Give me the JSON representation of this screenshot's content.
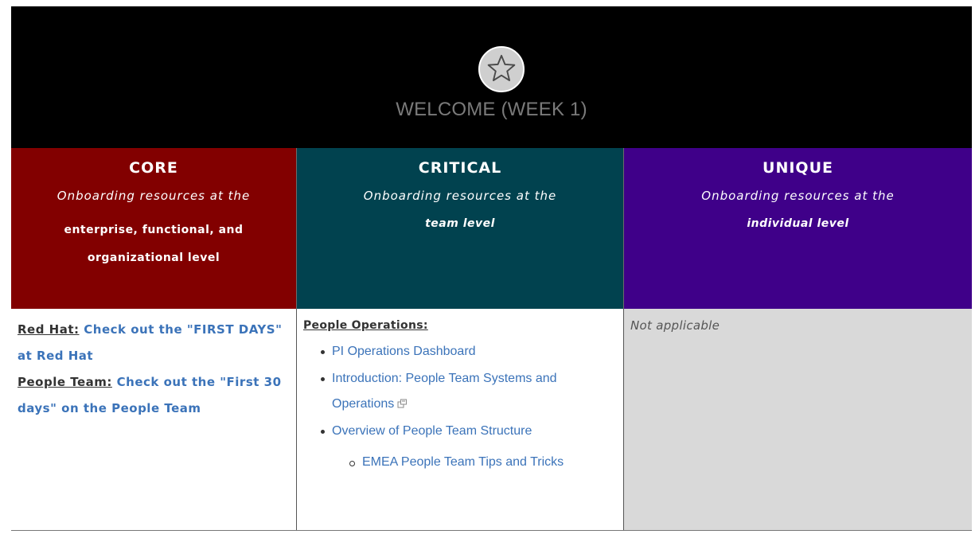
{
  "banner": {
    "icon": "star-icon",
    "title": "WELCOME (WEEK 1)"
  },
  "columns": [
    {
      "title": "CORE",
      "subtitle": "Onboarding resources at the",
      "emphasis_lines": [
        "enterprise, functional, and",
        "organizational level"
      ],
      "color": "#820000"
    },
    {
      "title": "CRITICAL",
      "subtitle": "Onboarding resources at the",
      "emphasis_lines": [
        "team level"
      ],
      "color": "#01424f"
    },
    {
      "title": "UNIQUE",
      "subtitle": "Onboarding resources at the",
      "emphasis_lines": [
        "individual level"
      ],
      "color": "#3f0089"
    }
  ],
  "core_cell": {
    "items": [
      {
        "label": "Red Hat:",
        "link": "Check out the \"FIRST DAYS\" at Red Hat"
      },
      {
        "label": "People Team:",
        "link": "Check out the \"First 30 days\" on the People Team"
      }
    ]
  },
  "critical_cell": {
    "section_label": "People Operations:",
    "links": [
      {
        "text": "PI Operations Dashboard"
      },
      {
        "text": "Introduction: People Team Systems and Operations",
        "icon": "external-link-icon"
      },
      {
        "text": "Overview of People Team Structure"
      }
    ],
    "sub_links": [
      {
        "text": "EMEA People Team Tips and Tricks"
      }
    ]
  },
  "unique_cell": {
    "text": "Not applicable"
  },
  "colors": {
    "link": "#3b73b9",
    "banner_bg": "#000000",
    "unique_cell_bg": "#d9d9d9"
  }
}
